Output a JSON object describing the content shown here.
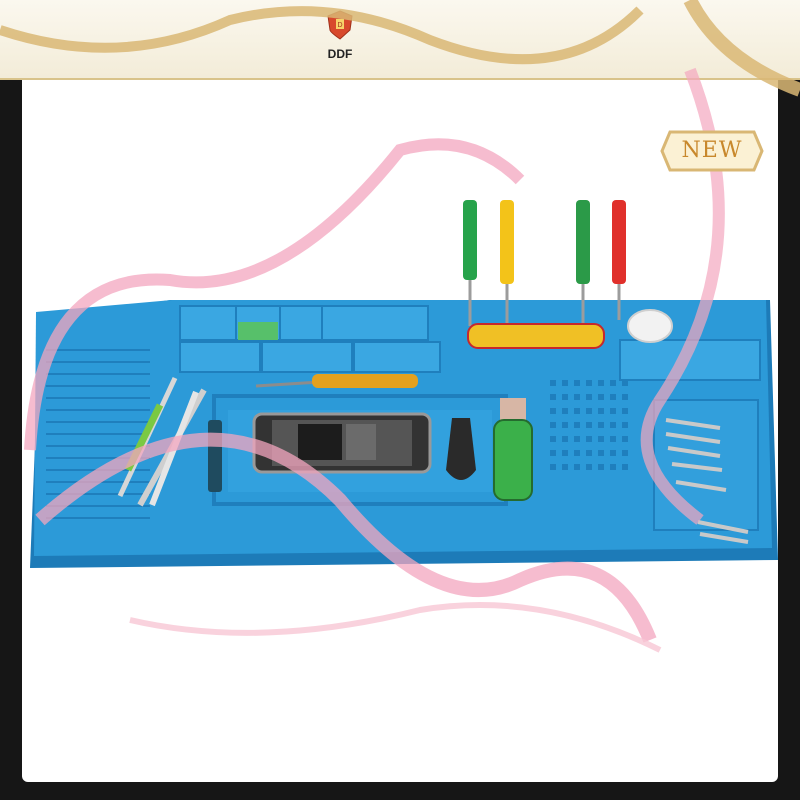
{
  "brand": {
    "name": "DDF"
  },
  "badge": {
    "label": "NEW"
  },
  "colors": {
    "mat_blue": "#2c9ad8",
    "mat_shadow": "#1d7bb8",
    "ribbon_pink": "#f3a6bf",
    "gold": "#d9b774",
    "badge_fill": "#fbf1d4"
  },
  "icons": {
    "brand_logo": "shield-crest-icon"
  }
}
